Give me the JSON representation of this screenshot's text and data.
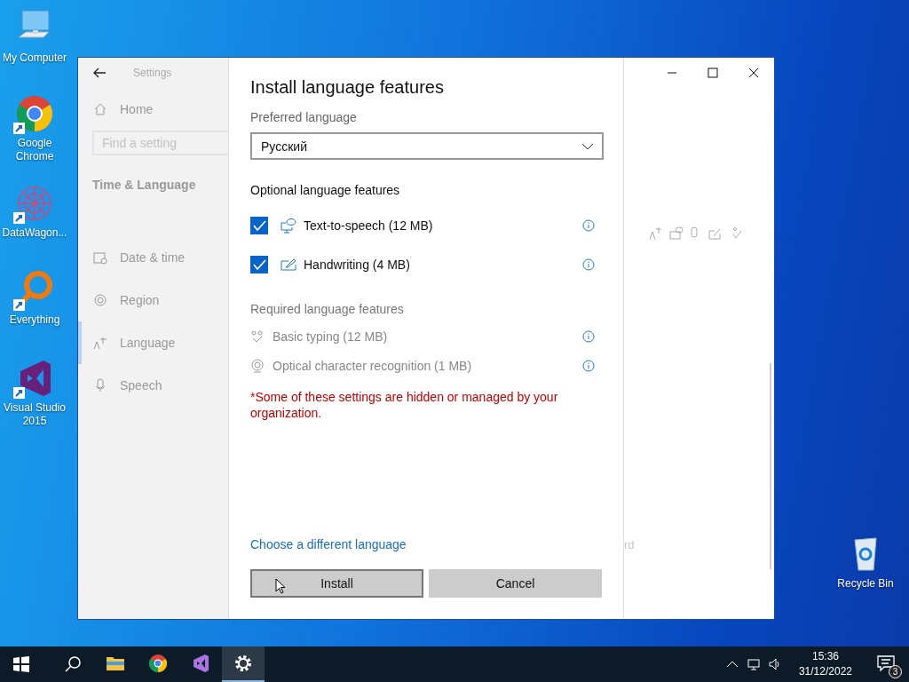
{
  "desktop_icons": [
    {
      "kind": "computer",
      "label": "My Computer",
      "shortcut": false
    },
    {
      "kind": "chrome",
      "label": "Google Chrome",
      "shortcut": true
    },
    {
      "kind": "datawagon",
      "label": "DataWagon...",
      "shortcut": true
    },
    {
      "kind": "everything",
      "label": "Everything",
      "shortcut": true
    },
    {
      "kind": "vs",
      "label": "Visual Studio 2015",
      "shortcut": true
    },
    {
      "kind": "recycle",
      "label": "Recycle Bin",
      "shortcut": false
    }
  ],
  "window": {
    "sidebar": {
      "title": "Settings",
      "home": "Home",
      "search": {
        "placeholder": "Find a setting"
      },
      "section": "Time & Language",
      "items": [
        {
          "kind": "date",
          "label": "Date & time",
          "selected": false
        },
        {
          "kind": "region",
          "label": "Region",
          "selected": false
        },
        {
          "kind": "language",
          "label": "Language",
          "selected": true
        },
        {
          "kind": "speech",
          "label": "Speech",
          "selected": false
        }
      ]
    },
    "background_text": "rd",
    "dialog": {
      "title": "Install language features",
      "preferred_label": "Preferred language",
      "language": {
        "value": "Русский"
      },
      "optional_heading": "Optional language features",
      "optional_features": [
        {
          "kind": "tts",
          "label": "Text-to-speech (12 MB)",
          "checked": true
        },
        {
          "kind": "handwriting",
          "label": "Handwriting (4 MB)",
          "checked": true
        }
      ],
      "required_heading": "Required language features",
      "required_features": [
        {
          "kind": "typing",
          "label": "Basic typing (12 MB)"
        },
        {
          "kind": "ocr",
          "label": "Optical character recognition (1 MB)"
        }
      ],
      "notice": "*Some of these settings are hidden or managed by your organization.",
      "link": "Choose a different language",
      "buttons": [
        {
          "label": "Install",
          "focused": true
        },
        {
          "label": "Cancel",
          "focused": false
        }
      ]
    }
  },
  "taskbar": {
    "apps": [
      {
        "kind": "explorer",
        "active": false
      },
      {
        "kind": "chrome",
        "active": false
      },
      {
        "kind": "vs",
        "active": false
      },
      {
        "kind": "settings",
        "active": true
      }
    ],
    "time": "15:36",
    "date": "31/12/2022",
    "notifications": "3"
  }
}
